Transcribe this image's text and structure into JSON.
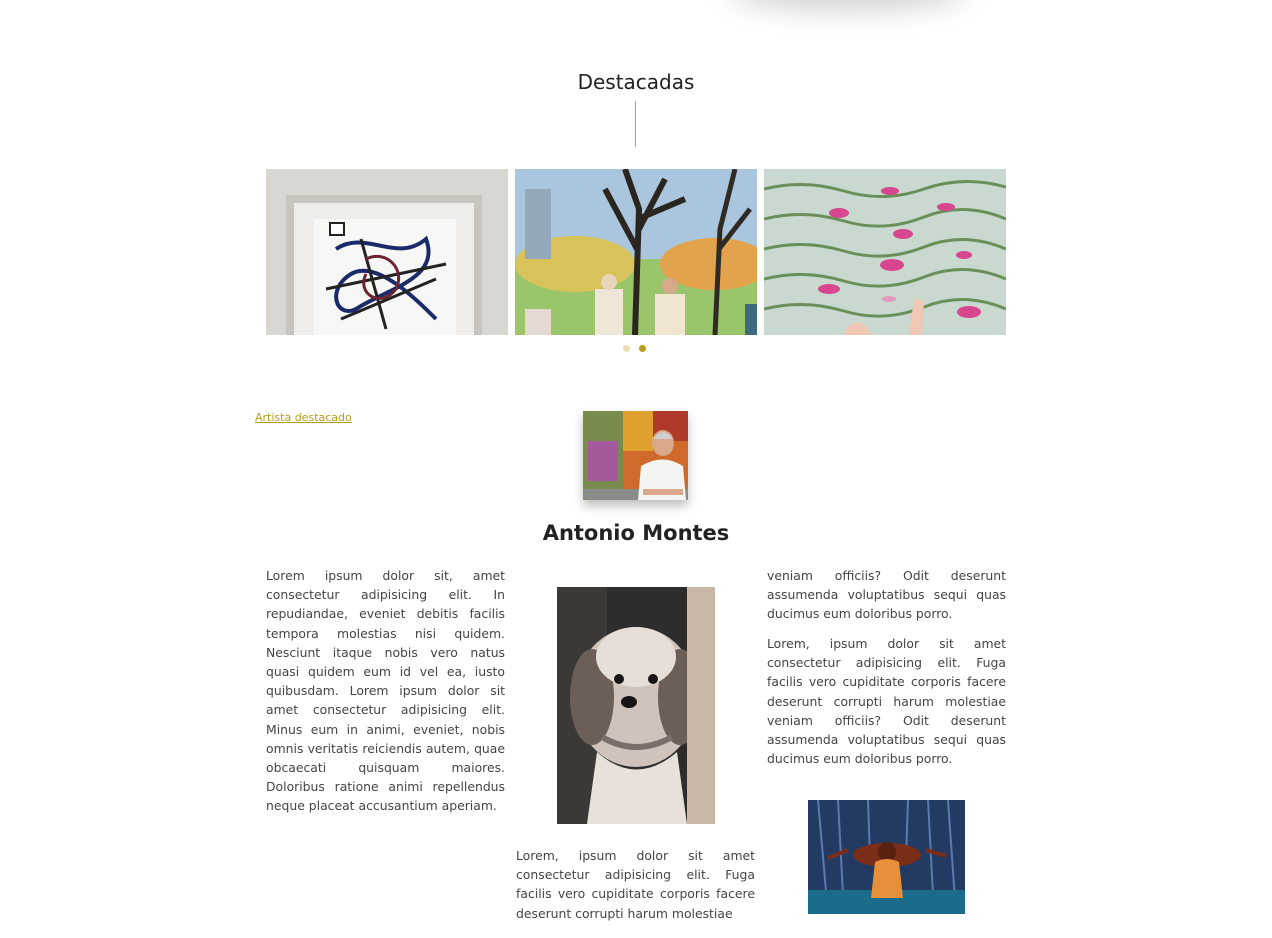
{
  "featured": {
    "title": "Destacadas",
    "slides": [
      {
        "alt": "Abstract framed ink painting",
        "icon": "abstract-painting-image"
      },
      {
        "alt": "Park scene with trees and people",
        "icon": "park-painting-image"
      },
      {
        "alt": "Water lilies on a pond",
        "icon": "waterlily-painting-image"
      }
    ],
    "dots": 2,
    "active_dot": 2
  },
  "artist": {
    "link_label": "Artista destacado",
    "name": "Antonio Montes",
    "paragraph_1": "Lorem ipsum dolor sit, amet consectetur adipisicing elit. In repudiandae, eveniet debitis facilis tempora molestias nisi quidem. Nesciunt itaque nobis vero natus quasi quidem eum id vel ea, iusto quibusdam. Lorem ipsum dolor sit amet consectetur adipisicing elit. Minus eum in animi, eveniet, nobis omnis veritatis reiciendis autem, quae obcaecati quisquam maiores. Doloribus ratione animi repellendus neque placeat accusantium aperiam.",
    "paragraph_2_tail": "veniam officiis? Odit deserunt assumenda voluptatibus sequi quas ducimus eum doloribus porro.",
    "paragraph_3": "Lorem, ipsum dolor sit amet consectetur adipisicing elit. Fuga facilis vero cupiditate corporis facere deserunt corrupti harum molestiae veniam officiis? Odit deserunt assumenda voluptatibus sequi quas ducimus eum doloribus porro.",
    "paragraph_center": "Lorem, ipsum dolor sit amet consectetur adipisicing elit. Fuga facilis vero cupiditate corporis facere deserunt corrupti harum molestiae"
  },
  "colors": {
    "accent": "#b89c1c",
    "text": "#444444",
    "heading": "#222222"
  }
}
